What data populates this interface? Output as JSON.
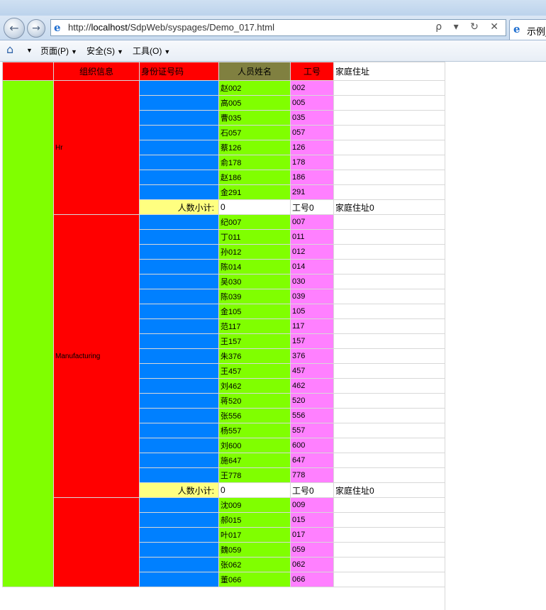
{
  "browser": {
    "url_prefix": "http://",
    "url_host": "localhost",
    "url_path": "/SdpWeb/syspages/Demo_017.html",
    "tab_title": "示例_",
    "addr_tools": "ρ ▾ ↻ ✕"
  },
  "commandbar": {
    "page": "页面(P)",
    "safety": "安全(S)",
    "tools": "工具(O)"
  },
  "table": {
    "headers": {
      "org": "组织信息",
      "id_card": "身份证号码",
      "name": "人员姓名",
      "job_no": "工号",
      "address": "家庭住址"
    },
    "subtotal": {
      "label": "人数小计:",
      "count": "0",
      "job_no": "工号0",
      "address": "家庭住址0"
    },
    "groups": [
      {
        "org": "Hr",
        "rows": [
          {
            "name": "赵002",
            "no": "002"
          },
          {
            "name": "高005",
            "no": "005"
          },
          {
            "name": "曹035",
            "no": "035"
          },
          {
            "name": "石057",
            "no": "057"
          },
          {
            "name": "蔡126",
            "no": "126"
          },
          {
            "name": "俞178",
            "no": "178"
          },
          {
            "name": "赵186",
            "no": "186"
          },
          {
            "name": "金291",
            "no": "291"
          }
        ],
        "has_subtotal": true
      },
      {
        "org": "Manufacturing",
        "rows": [
          {
            "name": "纪007",
            "no": "007"
          },
          {
            "name": "丁011",
            "no": "011"
          },
          {
            "name": "孙012",
            "no": "012"
          },
          {
            "name": "陈014",
            "no": "014"
          },
          {
            "name": "吴030",
            "no": "030"
          },
          {
            "name": "陈039",
            "no": "039"
          },
          {
            "name": "金105",
            "no": "105"
          },
          {
            "name": "范117",
            "no": "117"
          },
          {
            "name": "王157",
            "no": "157"
          },
          {
            "name": "朱376",
            "no": "376"
          },
          {
            "name": "王457",
            "no": "457"
          },
          {
            "name": "刘462",
            "no": "462"
          },
          {
            "name": "蒋520",
            "no": "520"
          },
          {
            "name": "张556",
            "no": "556"
          },
          {
            "name": "杨557",
            "no": "557"
          },
          {
            "name": "刘600",
            "no": "600"
          },
          {
            "name": "施647",
            "no": "647"
          },
          {
            "name": "王778",
            "no": "778"
          }
        ],
        "has_subtotal": true
      },
      {
        "org": "",
        "rows": [
          {
            "name": "沈009",
            "no": "009"
          },
          {
            "name": "郝015",
            "no": "015"
          },
          {
            "name": "叶017",
            "no": "017"
          },
          {
            "name": "魏059",
            "no": "059"
          },
          {
            "name": "张062",
            "no": "062"
          },
          {
            "name": "董066",
            "no": "066"
          }
        ],
        "has_subtotal": false
      }
    ]
  }
}
